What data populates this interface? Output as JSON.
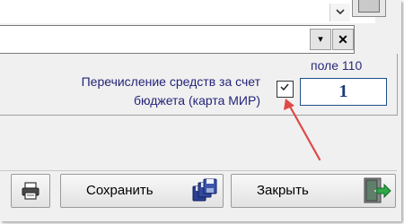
{
  "panel": {
    "field_caption": "поле 110",
    "transfer_label_line1": "Перечисление средств за счет",
    "transfer_label_line2": "бюджета (карта МИР)",
    "transfer_checked": true,
    "field_110_value": "1"
  },
  "combo": {
    "dropdown_glyph": "▾",
    "clear_glyph": "✕"
  },
  "toolbar": {
    "save_label": "Сохранить",
    "close_label": "Закрыть"
  },
  "icons": {
    "print": "printer-icon",
    "save": "floppy-disks-icon",
    "close": "exit-door-icon",
    "arrow": "annotation-arrow"
  },
  "colors": {
    "label_text": "#24247a",
    "field_border": "#1f4f8a",
    "field_value": "#1c3a78",
    "arrow": "#e04848"
  }
}
